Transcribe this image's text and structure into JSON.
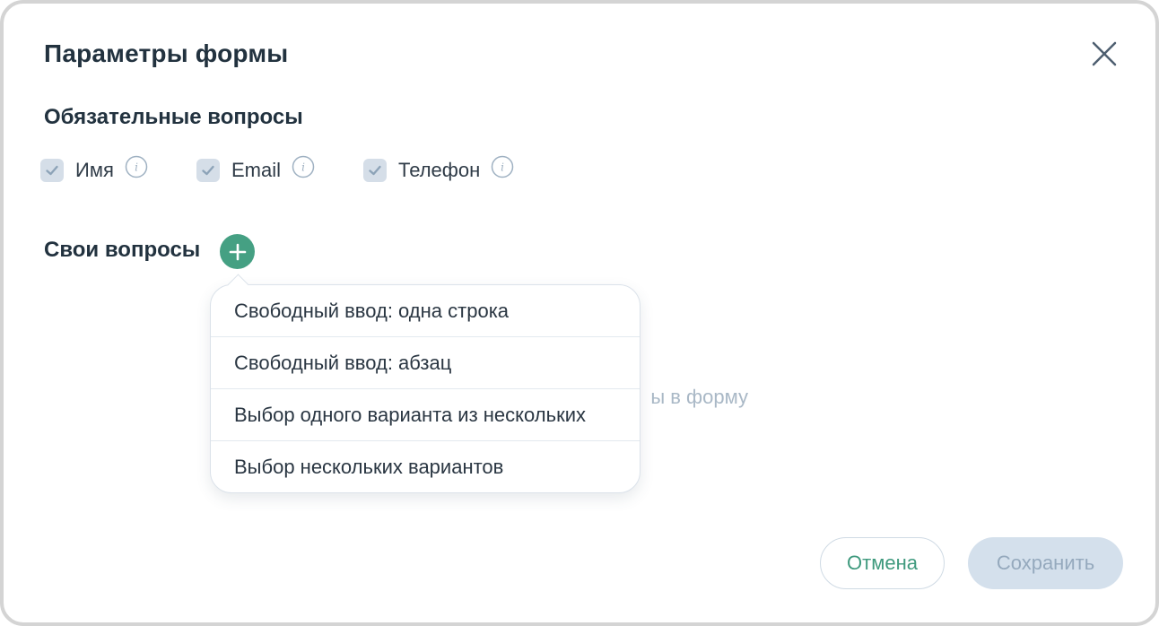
{
  "dialog": {
    "title": "Параметры формы",
    "close_icon": "close-icon"
  },
  "required": {
    "heading": "Обязательные вопросы",
    "items": [
      {
        "label": "Имя",
        "checked": true,
        "info_icon": "info-icon"
      },
      {
        "label": "Email",
        "checked": true,
        "info_icon": "info-icon"
      },
      {
        "label": "Телефон",
        "checked": true,
        "info_icon": "info-icon"
      }
    ]
  },
  "custom": {
    "heading": "Свои вопросы",
    "add_icon": "plus-icon",
    "hint_visible_fragment": "ы в форму"
  },
  "dropdown": {
    "items": [
      {
        "label": "Свободный ввод: одна строка"
      },
      {
        "label": "Свободный ввод: абзац"
      },
      {
        "label": "Выбор одного варианта из нескольких"
      },
      {
        "label": "Выбор нескольких вариантов"
      }
    ]
  },
  "footer": {
    "cancel_label": "Отмена",
    "save_label": "Сохранить"
  },
  "colors": {
    "accent": "#45a083",
    "text_dark": "#22323f",
    "checkbox_bg": "#d5dee8",
    "save_disabled_bg": "#d4e0ec",
    "hint": "#a9b8c6"
  }
}
